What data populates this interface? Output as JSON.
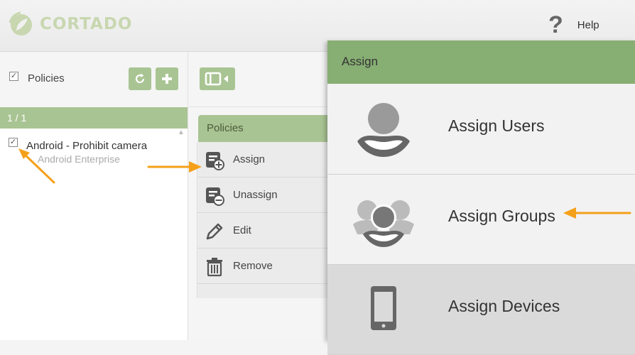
{
  "app": {
    "logo_text": "CORTADO",
    "brand_color": "#a9c493",
    "accent_color": "#87ae73"
  },
  "header": {
    "help_icon": "?",
    "help_label": "Help"
  },
  "policies_panel": {
    "title": "Policies",
    "select_all_checked": true,
    "counter": "1 / 1",
    "items": [
      {
        "name": "Android - Prohibit camera",
        "subtitle": "Android Enterprise",
        "checked": true
      }
    ]
  },
  "action_menu": {
    "tab_label": "Policies",
    "items": [
      {
        "label": "Assign",
        "icon": "assign-icon"
      },
      {
        "label": "Unassign",
        "icon": "unassign-icon"
      },
      {
        "label": "Edit",
        "icon": "pencil-icon"
      },
      {
        "label": "Remove",
        "icon": "trash-icon"
      }
    ]
  },
  "assign_panel": {
    "title": "Assign",
    "options": [
      {
        "label": "Assign Users",
        "icon": "user-icon"
      },
      {
        "label": "Assign Groups",
        "icon": "group-icon"
      },
      {
        "label": "Assign Devices",
        "icon": "device-icon",
        "highlighted": true
      }
    ]
  },
  "annotation_color": "#f5a01a"
}
